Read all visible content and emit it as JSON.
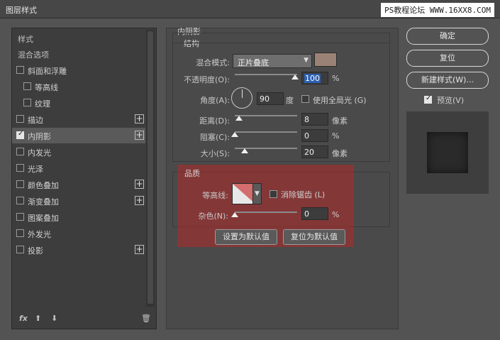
{
  "window": {
    "title": "图层样式",
    "watermark": "PS教程论坛 WWW.16XX8.COM"
  },
  "left_panel": {
    "header_styles": "样式",
    "header_blend": "混合选项",
    "items": [
      {
        "label": "斜面和浮雕",
        "checked": false,
        "plus": false,
        "indent": false
      },
      {
        "label": "等高线",
        "checked": false,
        "plus": false,
        "indent": true
      },
      {
        "label": "纹理",
        "checked": false,
        "plus": false,
        "indent": true
      },
      {
        "label": "描边",
        "checked": false,
        "plus": true,
        "indent": false
      },
      {
        "label": "内阴影",
        "checked": true,
        "plus": true,
        "indent": false,
        "active": true
      },
      {
        "label": "内发光",
        "checked": false,
        "plus": false,
        "indent": false
      },
      {
        "label": "光泽",
        "checked": false,
        "plus": false,
        "indent": false
      },
      {
        "label": "颜色叠加",
        "checked": false,
        "plus": true,
        "indent": false
      },
      {
        "label": "渐变叠加",
        "checked": false,
        "plus": true,
        "indent": false
      },
      {
        "label": "图案叠加",
        "checked": false,
        "plus": false,
        "indent": false
      },
      {
        "label": "外发光",
        "checked": false,
        "plus": false,
        "indent": false
      },
      {
        "label": "投影",
        "checked": false,
        "plus": true,
        "indent": false
      }
    ],
    "tools": {
      "fx": "fx",
      "up": "⬆",
      "down": "⬇",
      "trash": "🗑"
    }
  },
  "inner_shadow": {
    "section_title": "内阴影",
    "structure_title": "结构",
    "blend_mode_label": "混合模式:",
    "blend_mode_value": "正片叠底",
    "shadow_color": "#9b8276",
    "opacity_label": "不透明度(O):",
    "opacity_value": "100",
    "opacity_unit": "%",
    "angle_label": "角度(A):",
    "angle_value": "90",
    "angle_unit": "度",
    "global_light_label": "使用全局光 (G)",
    "distance_label": "距离(D):",
    "distance_value": "8",
    "distance_unit": "像素",
    "choke_label": "阻塞(C):",
    "choke_value": "0",
    "choke_unit": "%",
    "size_label": "大小(S):",
    "size_value": "20",
    "size_unit": "像素",
    "quality_title": "品质",
    "contour_label": "等高线:",
    "antialias_label": "消除锯齿 (L)",
    "noise_label": "杂色(N):",
    "noise_value": "0",
    "noise_unit": "%",
    "set_default": "设置为默认值",
    "reset_default": "复位为默认值"
  },
  "right_panel": {
    "ok": "确定",
    "reset": "复位",
    "new_style": "新建样式(W)...",
    "preview_label": "预览(V)"
  }
}
